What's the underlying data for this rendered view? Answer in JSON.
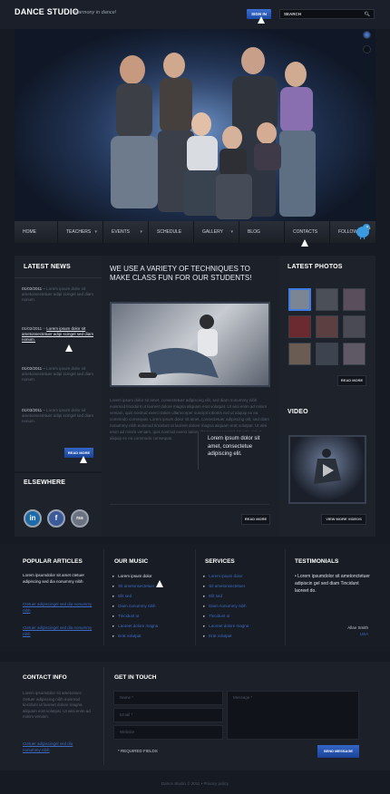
{
  "header": {
    "logo": "DANCE STUDIO",
    "slogan": "Harmony in dance!",
    "signin_label": "SIGN IN",
    "search_label": "SEARCH"
  },
  "nav": {
    "items": [
      {
        "label": "HOME",
        "caret": false
      },
      {
        "label": "TEACHERS",
        "caret": true
      },
      {
        "label": "EVENTS",
        "caret": true
      },
      {
        "label": "SCHEDULE",
        "caret": false
      },
      {
        "label": "GALLERY",
        "caret": true
      },
      {
        "label": "BLOG",
        "caret": false
      },
      {
        "label": "CONTACTS",
        "caret": false
      },
      {
        "label": "FOLLOW",
        "caret": false
      }
    ]
  },
  "latest_news": {
    "title": "LATEST NEWS",
    "items": [
      {
        "date": "01/02/2011",
        "text": "Lorem ipsum dolor sit ametonsectetuer adipi scingel sed diam nonum."
      },
      {
        "date": "01/02/2011",
        "text": "Lorem ipsum dolor sit ametonsectetuer adipi scingel sed diam nonum."
      },
      {
        "date": "01/02/2011",
        "text": "Lorem ipsum dolor sit ametonsectetuer adipi scingel sed diam nonum."
      },
      {
        "date": "01/03/2011",
        "text": "Lorem ipsum dolor sit ametonsectetuer adipi scingel sed diam nonum."
      }
    ],
    "more_label": "READ MORE"
  },
  "elsewhere": {
    "title": "ELSEWHERE",
    "icons": [
      "in",
      "f",
      "rss"
    ]
  },
  "center": {
    "heading": "WE USE A VARIETY OF TECHNIQUES TO MAKE CLASS FUN FOR OUR STUDENTS!",
    "paragraph": "Lorem ipsum dolor sit amet, consectetuer adipiscing elit, sed diam nonummy nibh euismod tincidunt ut laoreet dolore magna aliquam erat volutpat. Ut wisi enim ad minim veniam, quis nostrud exerci tation ullamcorper suscipit lobortis nisl ut aliquip ex ea commodo consequat. Lorem ipsum dolor sit amet, consectetuer adipiscing elit, sed diam nonummy nibh euismod tincidunt ut laoreet dolore magna aliquam erat volutpat. Ut wisi enim ad minim veniam, quis nostrud exerci tation ullamcorper suscipit lobortis nisl ut aliquip ex ea commodo consequat.",
    "quote": "Lorem ipsum dolor sit amet, consectetue adipiscing elit.",
    "more_label": "READ MORE"
  },
  "latest_photos": {
    "title": "LATEST PHOTOS",
    "more_label": "READ MORE"
  },
  "video": {
    "title": "VIDEO",
    "more_label": "VIEW MORE VIDEOS"
  },
  "popular_articles": {
    "title": "POPULAR ARTICLES",
    "lead": "Lorem ipsumdolor sit amet ctetuer adipiscing sed dia nonummy nibh",
    "links": [
      "Ctetuer adipiscingel sed dia nonummy nibh",
      "Ctetuer adipiscingel sed dia nonummy nibh"
    ]
  },
  "our_music": {
    "title": "OUR MUSIC",
    "items": [
      "Lorem ipsum dolor",
      "Sit ametonsectetuer",
      "Elit sed",
      "Diam nonummy nibh",
      "Tincidunt ut",
      "Laoreet dolore magna",
      "Erat volutpat"
    ]
  },
  "services": {
    "title": "SERVICES",
    "items": [
      "Lorem ipsum dolor",
      "Sit ametonsectetuer",
      "Elit sed",
      "Diam nonummy nibh",
      "Tincidunt ut",
      "Laoreet dolore magna",
      "Erat volutpat"
    ]
  },
  "testimonials": {
    "title": "TESTIMONIALS",
    "quote": "Lorem ipsumdolor sit ametonctetuer adipiscin gel sed diam Tincidunt laoreet do.",
    "author": "Allan Smith",
    "location": "USA"
  },
  "contact_info": {
    "title": "CONTACT INFO",
    "text": "Lorem ipsumdolor sit ametonsec ctetuer adipiscing nibh euismod tincidunt ut laoreet dolore magna aliquam erat volutpat. Ut wisi enim ad minim veniam.",
    "link": "Ctetuer adipiscingel sed dia nonummy nibh"
  },
  "get_in_touch": {
    "title": "GET IN TOUCH",
    "name_placeholder": "Name *",
    "email_placeholder": "Email *",
    "website_placeholder": "Website",
    "message_placeholder": "Message *",
    "required_note": "* REQUIRED FIELDS",
    "send_label": "SEND MESSAGE"
  },
  "footer": {
    "copyright": "Dance Studio © 2011 • Privacy policy"
  },
  "colors": {
    "accent": "#2a5bbf",
    "link": "#3d6bc4",
    "background": "#151a23",
    "panel": "#1d222b"
  }
}
